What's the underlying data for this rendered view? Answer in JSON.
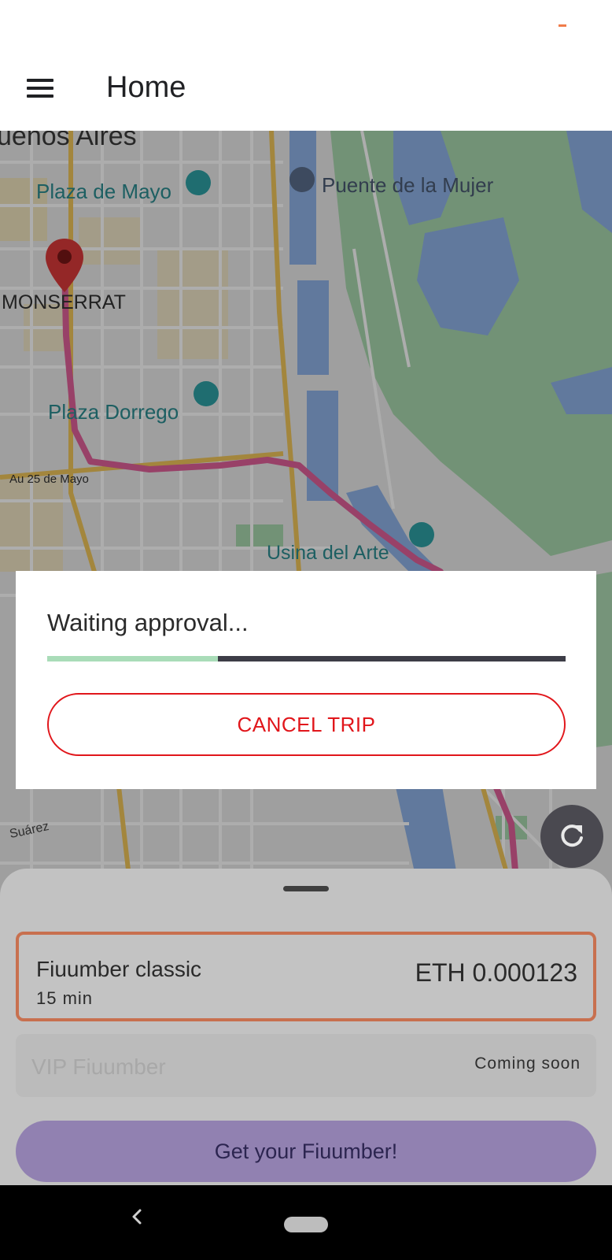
{
  "app": {
    "title": "Home",
    "accent": "#f07c4a"
  },
  "map": {
    "labels": {
      "city": "uenos Aires",
      "plaza_mayo": "Plaza de Mayo",
      "puente": "Puente de la Mujer",
      "monserrat": "MONSERRAT",
      "plaza_dorrego": "Plaza Dorrego",
      "au25": "Au 25 de Mayo",
      "usina": "Usina del Arte",
      "suarez": "Suárez"
    },
    "route_color": "#e0609a",
    "pin_color": "#db3a3a"
  },
  "dialog": {
    "title": "Waiting approval...",
    "progress": 0.33,
    "cancel_label": "CANCEL TRIP",
    "cancel_color": "#e1161b"
  },
  "icons": {
    "menu": "menu-icon",
    "refresh": "refresh-icon",
    "back": "back-icon",
    "pin": "map-pin-icon"
  },
  "sheet": {
    "options": [
      {
        "name": "Fiuumber classic",
        "time": "15 min",
        "price": "ETH 0.000123",
        "selected": true
      },
      {
        "name": "VIP Fiuumber",
        "badge": "Coming soon",
        "disabled": true
      }
    ],
    "cta_label": "Get your Fiuumber!"
  }
}
